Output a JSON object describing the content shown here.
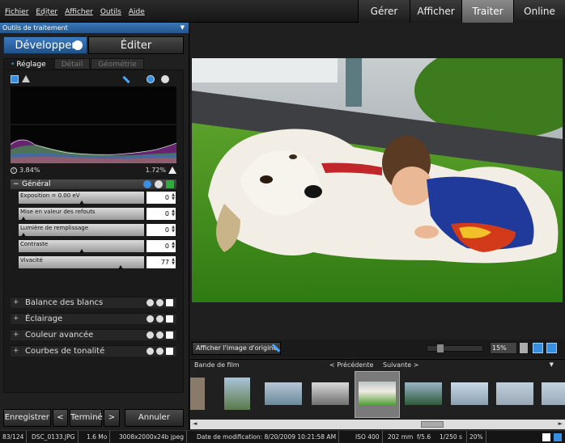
{
  "menu": [
    "Fichier",
    "Edi̲ter",
    "Afficher",
    "Outils",
    "Aide"
  ],
  "modes": [
    "Gérer",
    "Afficher",
    "Traiter",
    "Online"
  ],
  "active_mode": "Traiter",
  "panel": {
    "title": "Outils de traitement",
    "develop_label": "Développer",
    "edit_label": "Éditer",
    "tabs": [
      "Réglage",
      "Détail",
      "Géométrie"
    ],
    "histogram": {
      "shadow_clip": "3.84%",
      "highlight_clip": "1.72%"
    },
    "general": {
      "title": "Général",
      "sliders": [
        {
          "label": "Exposition = 0.00 eV",
          "value": "0",
          "level": 0.5
        },
        {
          "label": "Mise en valeur des refouts",
          "value": "0",
          "level": 0.02
        },
        {
          "label": "Lumière de remplissage",
          "value": "0",
          "level": 0.02
        },
        {
          "label": "Contraste",
          "value": "0",
          "level": 0.5
        },
        {
          "label": "Vivacité",
          "value": "77",
          "level": 0.82
        }
      ]
    },
    "sections": [
      "Balance des blancs",
      "Éclairage",
      "Couleur avancée",
      "Courbes de tonalité"
    ],
    "buttons": {
      "save": "Enregistrer",
      "prev": "<",
      "done": "Terminé",
      "next": ">",
      "cancel": "Annuler"
    }
  },
  "viewer": {
    "show_original": "Afficher l'image d'origine",
    "zoom": "15%"
  },
  "filmstrip": {
    "title": "Bande de film",
    "prev": "< Précédente",
    "next": "Suivante >",
    "menu": "▼"
  },
  "status": {
    "index": "83/124",
    "filename": "DSC_0133.JPG",
    "size": "1.6 Mo",
    "dimensions": "3008x2000x24b jpeg",
    "modified": "Date de modification: 8/20/2009 10:21:58 AM",
    "iso": "ISO 400",
    "focal": "202 mm",
    "aperture": "f/5.6",
    "shutter": "1/250 s",
    "zoom": "20%"
  },
  "colors": {
    "accent": "#2f6db0",
    "active_mode": "#6f6f6f"
  }
}
